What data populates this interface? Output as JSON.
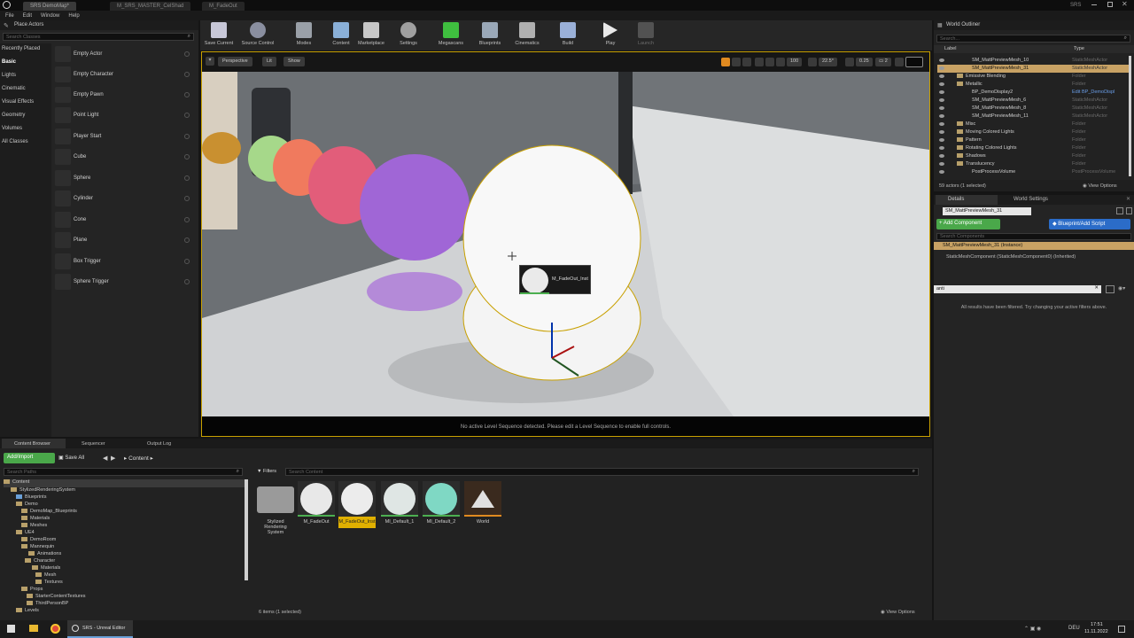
{
  "window": {
    "tabs": [
      "SRS DemoMap*",
      "M_SRS_MASTER_CelShad",
      "M_FadeOut"
    ],
    "project": "SRS"
  },
  "menu": [
    "File",
    "Edit",
    "Window",
    "Help"
  ],
  "place_actors": {
    "title": "Place Actors",
    "search_placeholder": "Search Classes",
    "categories": [
      "Recently Placed",
      "Basic",
      "Lights",
      "Cinematic",
      "Visual Effects",
      "Geometry",
      "Volumes",
      "All Classes"
    ],
    "actors": [
      "Empty Actor",
      "Empty Character",
      "Empty Pawn",
      "Point Light",
      "Player Start",
      "Cube",
      "Sphere",
      "Cylinder",
      "Cone",
      "Plane",
      "Box Trigger",
      "Sphere Trigger"
    ]
  },
  "toolbar": {
    "buttons": [
      "Save Current",
      "Source Control",
      "Modes",
      "Content",
      "Marketplace",
      "Settings",
      "Megascans",
      "Blueprints",
      "Cinematics",
      "Build",
      "Play",
      "Launch"
    ]
  },
  "viewport": {
    "perspective": "Perspective",
    "lit": "Lit",
    "show": "Show",
    "grid_snap": "100",
    "rot_snap": "22.5°",
    "scale_snap": "0.25",
    "cam_speed": "2",
    "tooltip": "M_FadeOut_Inst",
    "sequencer_msg": "No active Level Sequence detected. Please edit a Level Sequence to enable full controls."
  },
  "outliner": {
    "title": "World Outliner",
    "search_placeholder": "Search...",
    "col_label": "Label",
    "col_type": "Type",
    "rows": [
      {
        "label": "SM_MattPreviewMesh_10",
        "type": "StaticMeshActor"
      },
      {
        "label": "SM_MattPreviewMesh_31",
        "type": "StaticMeshActor"
      },
      {
        "label": "Emissive Blending",
        "type": "Folder"
      },
      {
        "label": "Metallic",
        "type": "Folder"
      },
      {
        "label": "BP_DemoDisplay2",
        "type": "Edit BP_DemoDispl"
      },
      {
        "label": "SM_MattPreviewMesh_6",
        "type": "StaticMeshActor"
      },
      {
        "label": "SM_MattPreviewMesh_8",
        "type": "StaticMeshActor"
      },
      {
        "label": "SM_MattPreviewMesh_11",
        "type": "StaticMeshActor"
      },
      {
        "label": "Misc",
        "type": "Folder"
      },
      {
        "label": "Moving Colored Lights",
        "type": "Folder"
      },
      {
        "label": "Pattern",
        "type": "Folder"
      },
      {
        "label": "Rotating Colored Lights",
        "type": "Folder"
      },
      {
        "label": "Shadows",
        "type": "Folder"
      },
      {
        "label": "Translucency",
        "type": "Folder"
      },
      {
        "label": "PostProcessVolume",
        "type": "PostProcessVolume"
      }
    ],
    "status": "59 actors (1 selected)",
    "view_options": "View Options"
  },
  "details": {
    "tab_details": "Details",
    "tab_world": "World Settings",
    "name_value": "SM_MattPreviewMesh_31",
    "add_component": "+ Add Component",
    "blueprint_script": "Blueprint/Add Script",
    "component_search": "Search Components",
    "instance_row": "SM_MattPreviewMesh_31 (Instance)",
    "component_row": "StaticMeshComponent (StaticMeshComponent0) (Inherited)",
    "search_value": "anti",
    "filtered_msg": "All results have been filtered. Try changing your active filters above."
  },
  "bottom": {
    "tabs": [
      "Content Browser",
      "Sequencer",
      "Output Log"
    ],
    "add_import": "Add/Import",
    "save_all": "Save All",
    "crumb": "Content",
    "search_paths": "Search Paths",
    "filters": "Filters",
    "search_content": "Search Content",
    "tree": [
      "Content",
      "StylizedRenderingSystem",
      "Blueprints",
      "Demo",
      "DemoMap_Blueprints",
      "Materials",
      "Meshes",
      "UE4",
      "DemoRoom",
      "Mannequin",
      "Animations",
      "Character",
      "Materials",
      "Mesh",
      "Textures",
      "Props",
      "StarterContentTextures",
      "ThirdPersonBP",
      "Levels"
    ],
    "assets": [
      "Stylized Rendering System",
      "M_FadeOut",
      "M_FadeOut_Inst",
      "MI_Default_1",
      "MI_Default_2",
      "World"
    ],
    "status": "6 items (1 selected)",
    "view_options": "View Options"
  },
  "taskbar": {
    "app": "SRS - Unreal Editor",
    "lang": "DEU",
    "time": "17:51",
    "date": "11.11.2022"
  }
}
